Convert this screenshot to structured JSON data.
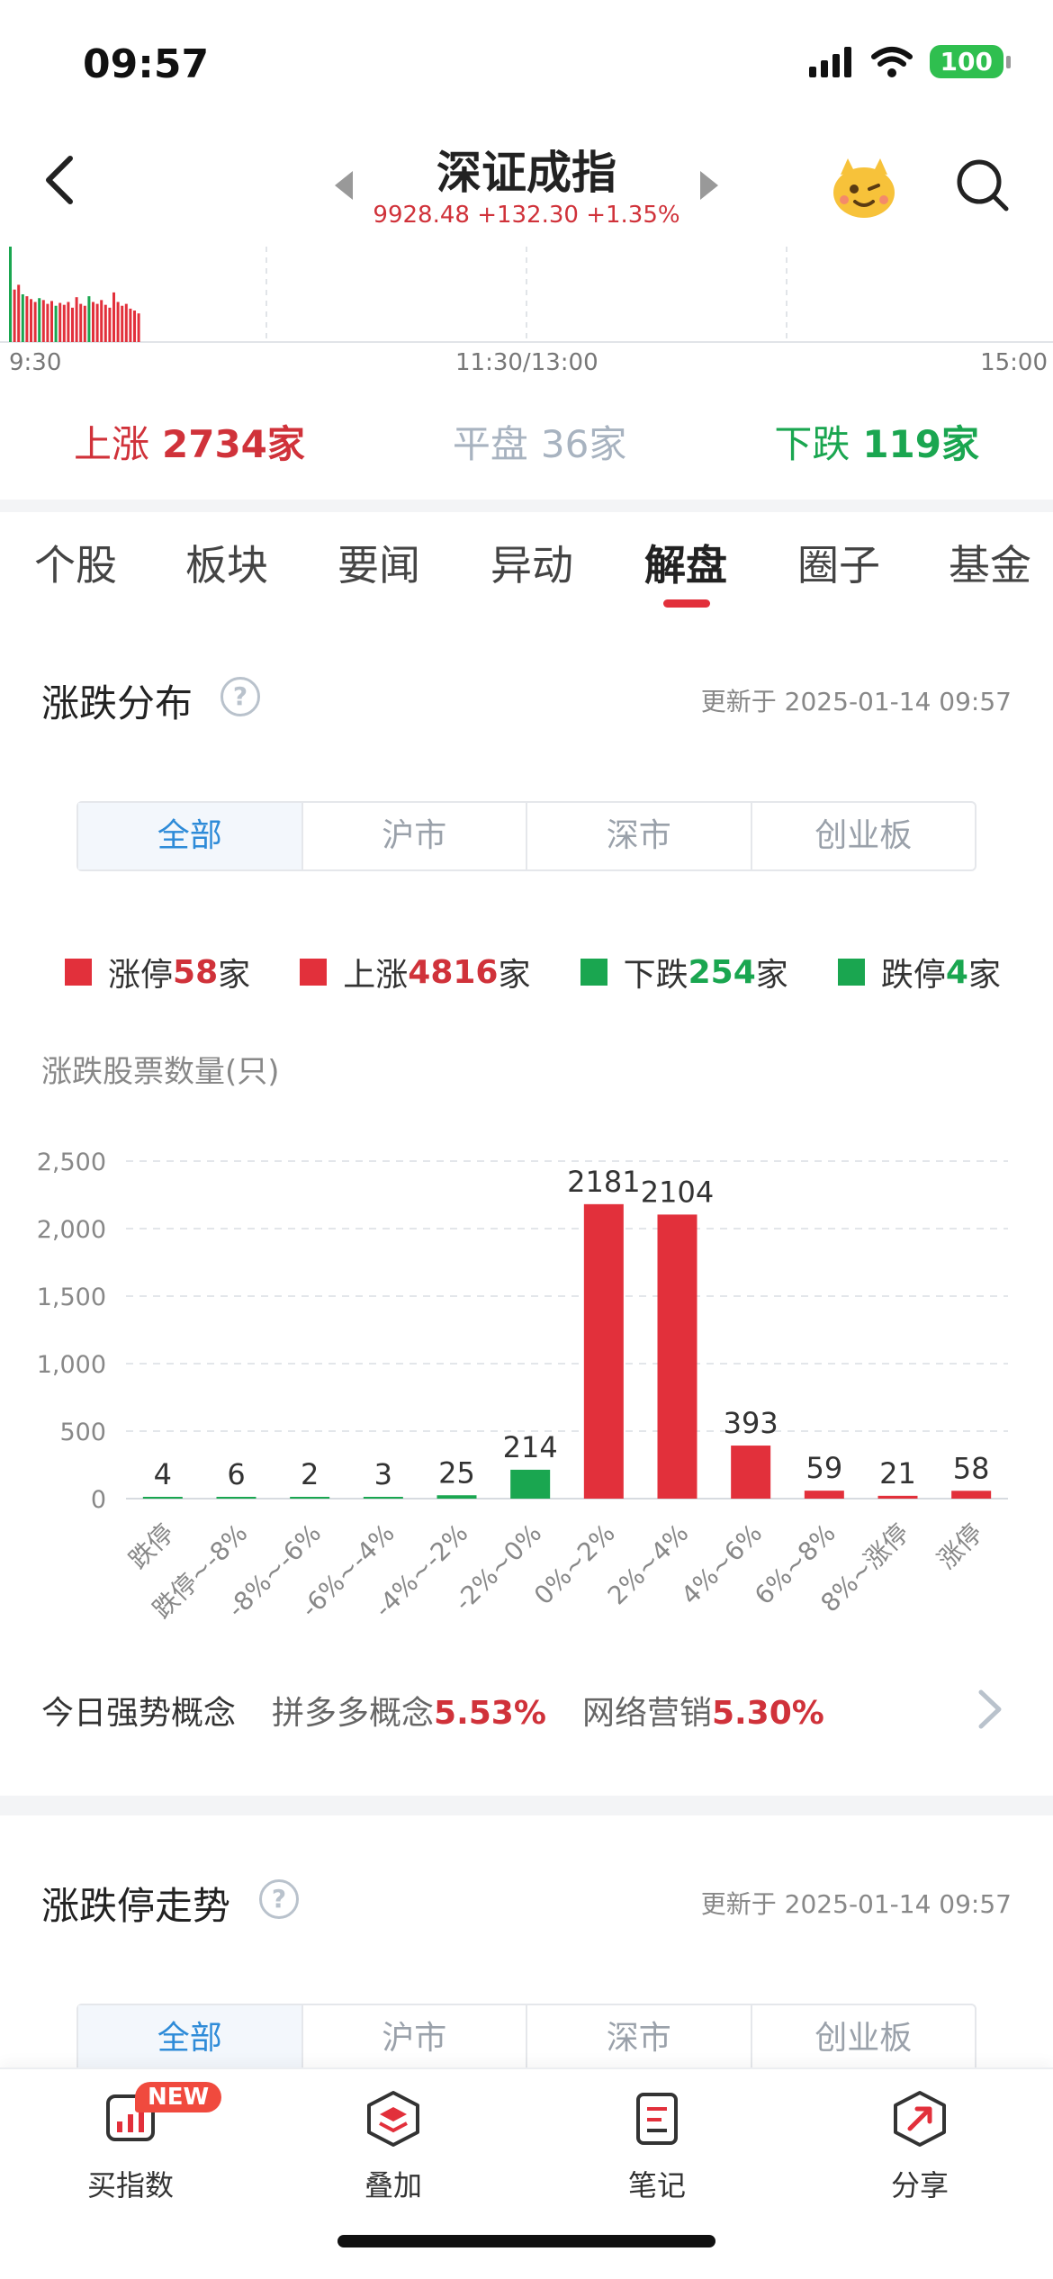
{
  "status": {
    "time": "09:57",
    "battery": "100"
  },
  "header": {
    "title": "深证成指",
    "quote": "9928.48 +132.30 +1.35%"
  },
  "mini_chart": {
    "times": [
      "9:30",
      "11:30/13:00",
      "15:00"
    ],
    "bars": [
      {
        "v": 1.0,
        "c": "g"
      },
      {
        "v": 0.55,
        "c": "r"
      },
      {
        "v": 0.6,
        "c": "r"
      },
      {
        "v": 0.5,
        "c": "g"
      },
      {
        "v": 0.48,
        "c": "r"
      },
      {
        "v": 0.45,
        "c": "r"
      },
      {
        "v": 0.42,
        "c": "r"
      },
      {
        "v": 0.46,
        "c": "g"
      },
      {
        "v": 0.44,
        "c": "r"
      },
      {
        "v": 0.4,
        "c": "r"
      },
      {
        "v": 0.43,
        "c": "r"
      },
      {
        "v": 0.38,
        "c": "g"
      },
      {
        "v": 0.41,
        "c": "r"
      },
      {
        "v": 0.39,
        "c": "r"
      },
      {
        "v": 0.42,
        "c": "r"
      },
      {
        "v": 0.36,
        "c": "r"
      },
      {
        "v": 0.47,
        "c": "r"
      },
      {
        "v": 0.4,
        "c": "r"
      },
      {
        "v": 0.38,
        "c": "r"
      },
      {
        "v": 0.48,
        "c": "g"
      },
      {
        "v": 0.42,
        "c": "r"
      },
      {
        "v": 0.4,
        "c": "r"
      },
      {
        "v": 0.44,
        "c": "r"
      },
      {
        "v": 0.39,
        "c": "r"
      },
      {
        "v": 0.36,
        "c": "r"
      },
      {
        "v": 0.52,
        "c": "r"
      },
      {
        "v": 0.42,
        "c": "r"
      },
      {
        "v": 0.38,
        "c": "r"
      },
      {
        "v": 0.4,
        "c": "r"
      },
      {
        "v": 0.35,
        "c": "r"
      },
      {
        "v": 0.33,
        "c": "r"
      },
      {
        "v": 0.3,
        "c": "r"
      }
    ]
  },
  "counts": {
    "up_label": "上涨",
    "up_value": "2734家",
    "flat_label": "平盘",
    "flat_value": "36家",
    "down_label": "下跌",
    "down_value": "119家"
  },
  "tabs": [
    "个股",
    "板块",
    "要闻",
    "异动",
    "解盘",
    "圈子",
    "基金"
  ],
  "active_tab": "解盘",
  "distribution": {
    "title": "涨跌分布",
    "help": "?",
    "updated": "更新于 2025-01-14 09:57",
    "segments": [
      "全部",
      "沪市",
      "深市",
      "创业板"
    ],
    "legend": [
      {
        "label": "涨停",
        "value": "58",
        "unit": "家",
        "color": "#e2303b"
      },
      {
        "label": "上涨",
        "value": "4816",
        "unit": "家",
        "color": "#e2303b"
      },
      {
        "label": "下跌",
        "value": "254",
        "unit": "家",
        "color": "#1aa650"
      },
      {
        "label": "跌停",
        "value": "4",
        "unit": "家",
        "color": "#1aa650"
      }
    ],
    "ylabel": "涨跌股票数量(只)"
  },
  "chart_data": {
    "type": "bar",
    "title": "",
    "xlabel": "",
    "ylabel": "涨跌股票数量(只)",
    "categories": [
      "跌停",
      "跌停~-8%",
      "-8%~-6%",
      "-6%~-4%",
      "-4%~-2%",
      "-2%~0%",
      "0%~2%",
      "2%~4%",
      "4%~6%",
      "6%~8%",
      "8%~涨停",
      "涨停"
    ],
    "values": [
      4,
      6,
      2,
      3,
      25,
      214,
      2181,
      2104,
      393,
      59,
      21,
      58
    ],
    "colors": [
      "#1aa650",
      "#1aa650",
      "#1aa650",
      "#1aa650",
      "#1aa650",
      "#1aa650",
      "#e2303b",
      "#e2303b",
      "#e2303b",
      "#e2303b",
      "#e2303b",
      "#e2303b"
    ],
    "yticks": [
      "0",
      "500",
      "1,000",
      "1,500",
      "2,000",
      "2,500"
    ],
    "ylim": [
      0,
      2500
    ],
    "grid": true
  },
  "concepts": {
    "label": "今日强势概念",
    "items": [
      {
        "name": "拼多多概念",
        "value": "5.53%"
      },
      {
        "name": "网络营销",
        "value": "5.30%"
      }
    ]
  },
  "trend": {
    "title": "涨跌停走势",
    "help": "?",
    "updated": "更新于 2025-01-14 09:57",
    "segments": [
      "全部",
      "沪市",
      "深市",
      "创业板"
    ]
  },
  "bottom_nav": {
    "badge": "NEW",
    "items": [
      "买指数",
      "叠加",
      "笔记",
      "分享"
    ]
  }
}
